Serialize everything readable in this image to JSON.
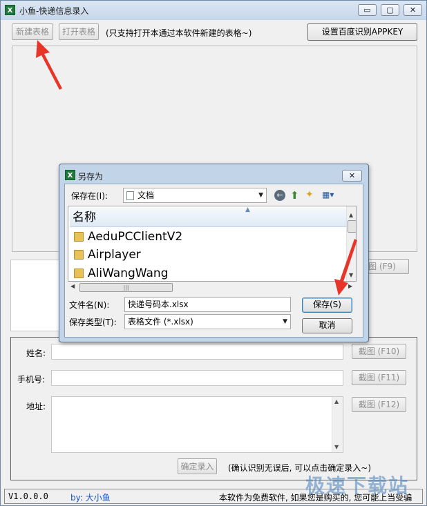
{
  "window": {
    "title": "小鱼-快递信息录入",
    "minimize": "▭",
    "maximize": "▢",
    "close": "✕"
  },
  "toolbar": {
    "new_table": "新建表格",
    "open_table": "打开表格",
    "note": "(只支持打开本通过本软件新建的表格~)",
    "set_key": "设置百度识别APPKEY"
  },
  "capture_f9": "图 (F9)",
  "form": {
    "name_label": "姓名:",
    "phone_label": "手机号:",
    "address_label": "地址:",
    "capture_f10": "截图 (F10)",
    "capture_f11": "截图 (F11)",
    "capture_f12": "截图 (F12)",
    "confirm": "确定录入",
    "confirm_note": "(确认识别无误后, 可以点击确定录入~)"
  },
  "status": {
    "version": "V1.0.0.0",
    "author": "by: 大小鱼",
    "notice": "本软件为免费软件, 如果您是购买的, 您可能上当受骗"
  },
  "dialog": {
    "title": "另存为",
    "save_in_label": "保存在(I):",
    "save_in_value": "文档",
    "header": "名称",
    "files": [
      "AeduPCClientV2",
      "Airplayer",
      "AliWangWang"
    ],
    "filename_label": "文件名(N):",
    "filename_value": "快递号码本.xlsx",
    "filetype_label": "保存类型(T):",
    "filetype_value": "表格文件 (*.xlsx)",
    "save": "保存(S)",
    "cancel": "取消"
  },
  "watermark": "极速下载站"
}
